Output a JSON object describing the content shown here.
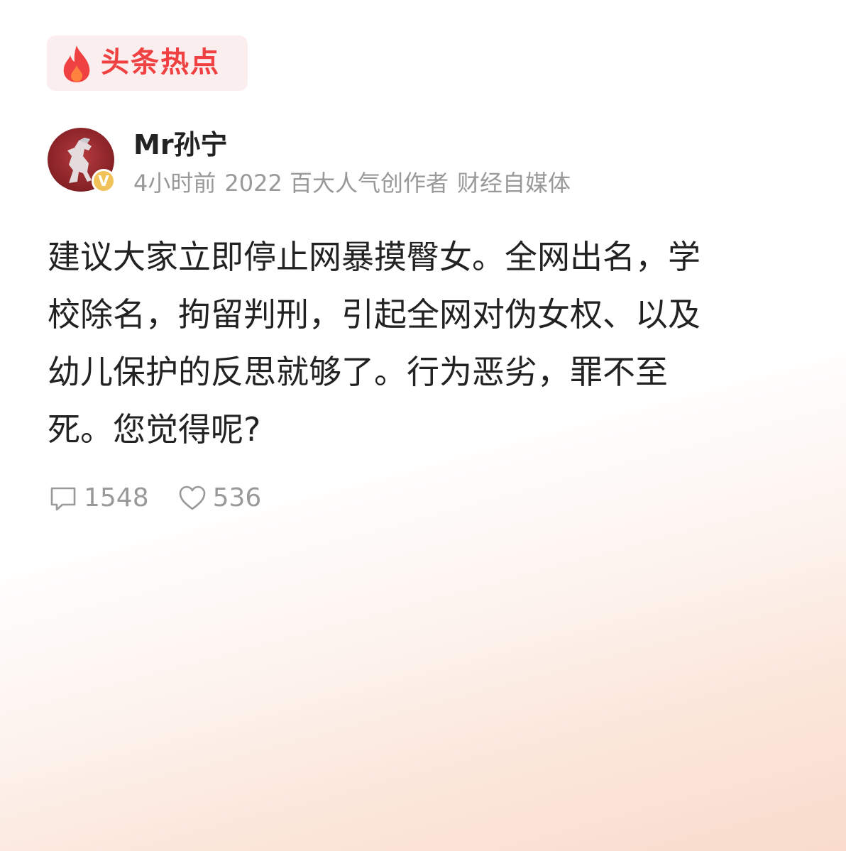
{
  "badge": {
    "icon": "flame-icon",
    "label": "头条热点",
    "color": "#f04142",
    "background": "#fbeeee"
  },
  "author": {
    "name": "Mr孙宁",
    "avatar_icon": "horse-emblem-icon",
    "verified_mark": "V",
    "verified_color": "#f2c25a"
  },
  "meta": {
    "time": "4小时前",
    "tag": "2022 百大人气创作者",
    "category": "财经自媒体"
  },
  "post": {
    "lines": [
      "建议大家立即停止网暴摸臀女。全网出名，学",
      "校除名，拘留判刑，引起全网对伪女权、以及",
      "幼儿保护的反思就够了。行为恶劣，罪不至",
      "死。您觉得呢?"
    ]
  },
  "actions": {
    "comment": {
      "icon": "comment-icon",
      "count": "1548"
    },
    "like": {
      "icon": "heart-icon",
      "count": "536"
    }
  }
}
